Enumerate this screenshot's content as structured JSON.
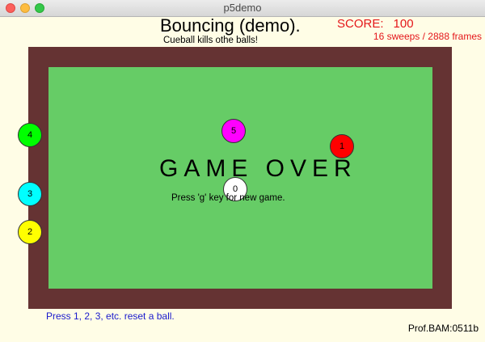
{
  "window": {
    "title": "p5demo"
  },
  "game": {
    "title": "Bouncing (demo).",
    "subtitle": "Cueball kills othe balls!",
    "score_label": "SCORE:",
    "score_value": "100",
    "sweeps_text": "16 sweeps / 2888 frames",
    "game_over_text": "GAME OVER",
    "new_game_hint": "Press 'g'  key for new game.",
    "reset_hint": "Press 1, 2, 3, etc. reset a ball.",
    "signature": "Prof.BAM:0511b"
  },
  "balls": [
    {
      "label": "0",
      "color": "#ffffff"
    },
    {
      "label": "1",
      "color": "#ff0000"
    },
    {
      "label": "2",
      "color": "#ffff00"
    },
    {
      "label": "3",
      "color": "#00ffff"
    },
    {
      "label": "4",
      "color": "#00ff00"
    },
    {
      "label": "5",
      "color": "#ff00ff"
    }
  ],
  "colors": {
    "rail": "#653333",
    "felt": "#66cc66",
    "score": "#e4161a",
    "hint": "#1a1acc",
    "background": "#fffde6"
  }
}
